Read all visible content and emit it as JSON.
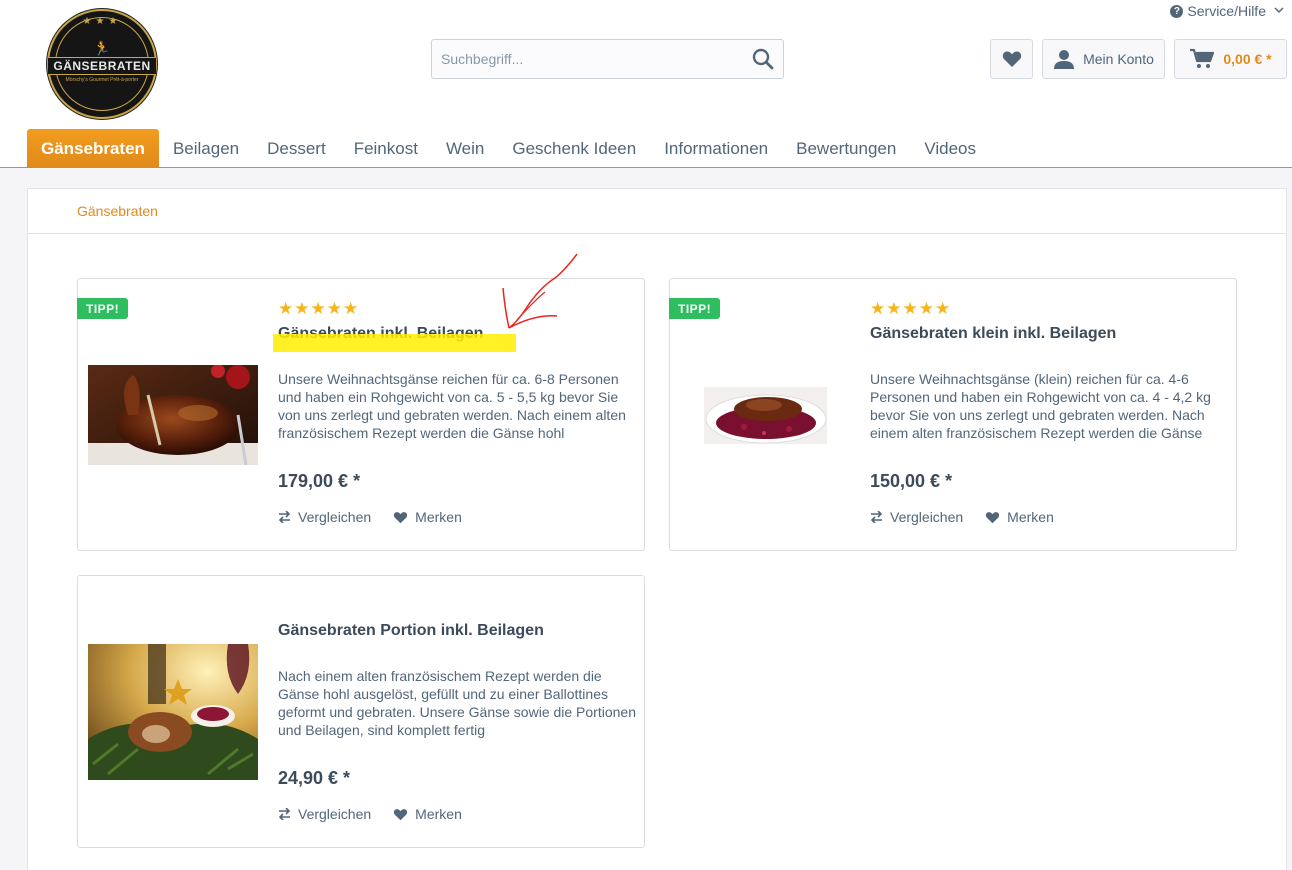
{
  "header": {
    "service_label": "Service/Hilfe",
    "logo_brand": "GÄNSEBRATEN",
    "logo_tagline": "Mörschy's Gourmet Prêt-à-porter",
    "search_placeholder": "Suchbegriff...",
    "account_label": "Mein Konto",
    "cart_amount": "0,00 € *"
  },
  "nav": {
    "items": [
      "Gänsebraten",
      "Beilagen",
      "Dessert",
      "Feinkost",
      "Wein",
      "Geschenk Ideen",
      "Informationen",
      "Bewertungen",
      "Videos"
    ],
    "active_index": 0
  },
  "breadcrumb": "Gänsebraten",
  "products": [
    {
      "badge": "TIPP!",
      "stars": "★★★★★",
      "rating": 5,
      "title": "Gänsebraten inkl. Beilagen",
      "description": "Unsere Weihnachtsgänse reichen für ca. 6-8 Personen und haben ein Rohgewicht von ca. 5 - 5,5 kg bevor Sie von uns zerlegt und gebraten werden. Nach einem alten französischem Rezept werden die Gänse hohl",
      "price": "179,00 € *",
      "compare_label": "Vergleichen",
      "wishlist_label": "Merken"
    },
    {
      "badge": "TIPP!",
      "stars": "★★★★★",
      "rating": 5,
      "title": "Gänsebraten klein inkl. Beilagen",
      "description": "Unsere Weihnachtsgänse (klein) reichen für ca. 4-6 Personen und haben ein Rohgewicht von ca. 4 - 4,2 kg bevor Sie von uns zerlegt und gebraten werden. Nach einem alten französischem Rezept werden die Gänse",
      "price": "150,00 € *",
      "compare_label": "Vergleichen",
      "wishlist_label": "Merken"
    },
    {
      "title": "Gänsebraten Portion inkl. Beilagen",
      "description": "Nach einem alten französischem Rezept werden die Gänse hohl ausgelöst, gefüllt und zu einer Ballottines geformt und gebraten. Unsere Gänse sowie die Portionen und Beilagen, sind komplett fertig",
      "price": "24,90 € *",
      "compare_label": "Vergleichen",
      "wishlist_label": "Merken"
    }
  ],
  "colors": {
    "accent": "#e08a1b",
    "badge": "#2ebd5f",
    "stars": "#f6b51b",
    "highlight": "#ffef00",
    "annotation": "#e8281e"
  }
}
